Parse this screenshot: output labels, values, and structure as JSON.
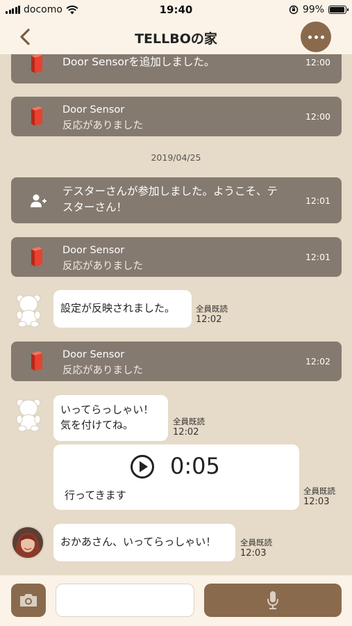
{
  "status_bar": {
    "carrier": "docomo",
    "time": "19:40",
    "battery": "99%",
    "battery_level": 0.99
  },
  "header": {
    "title": "TELLBOの家",
    "back_icon": "chevron-left-icon",
    "menu_icon": "more-icon"
  },
  "messages": {
    "card1": {
      "text": "Door Sensorを追加しました。",
      "time": "12:00"
    },
    "card2": {
      "title": "Door Sensor",
      "subtitle": "反応がありました",
      "time": "12:00"
    },
    "date": "2019/04/25",
    "card3": {
      "line1": "テスターさんが参加しました。ようこそ、テ",
      "line2": "スターさん！",
      "time": "12:01"
    },
    "card4": {
      "title": "Door Sensor",
      "subtitle": "反応がありました",
      "time": "12:01"
    },
    "bubble1": {
      "text": "設定が反映されました。",
      "read": "全員既読",
      "time": "12:02"
    },
    "card5": {
      "title": "Door Sensor",
      "subtitle": "反応がありました",
      "time": "12:02"
    },
    "bubble2": {
      "line1": "いってらっしゃい！",
      "line2": "気を付けてね。",
      "read": "全員既読",
      "time": "12:02"
    },
    "voice": {
      "duration": "0:05",
      "label": "行ってきます",
      "read": "全員既読",
      "time": "12:03"
    },
    "bubble3": {
      "text": "おかあさん、いってらっしゃい！",
      "read": "全員既読",
      "time": "12:03"
    }
  },
  "input_bar": {
    "placeholder": "",
    "camera_icon": "camera-icon",
    "mic_icon": "microphone-icon"
  },
  "colors": {
    "background": "#e6dac8",
    "header": "#fbf3e8",
    "system_card": "#847a70",
    "accent_brown": "#8a6a4c",
    "sensor_red": "#e8412f"
  }
}
